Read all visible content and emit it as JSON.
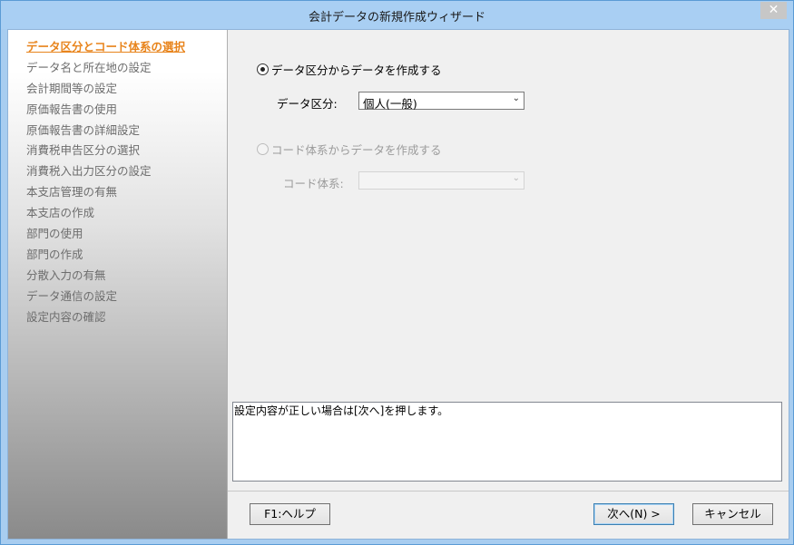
{
  "window": {
    "title": "会計データの新規作成ウィザード",
    "close_glyph": "✕"
  },
  "sidebar": {
    "steps": [
      {
        "label": "データ区分とコード体系の選択",
        "active": true
      },
      {
        "label": "データ名と所在地の設定"
      },
      {
        "label": "会計期間等の設定"
      },
      {
        "label": "原価報告書の使用"
      },
      {
        "label": "原価報告書の詳細設定"
      },
      {
        "label": "消費税申告区分の選択"
      },
      {
        "label": "消費税入出力区分の設定"
      },
      {
        "label": "本支店管理の有無"
      },
      {
        "label": "本支店の作成"
      },
      {
        "label": "部門の使用"
      },
      {
        "label": "部門の作成"
      },
      {
        "label": "分散入力の有無"
      },
      {
        "label": "データ通信の設定"
      },
      {
        "label": "設定内容の確認"
      }
    ]
  },
  "main": {
    "option_data_category": {
      "label": "データ区分からデータを作成する",
      "selected": true
    },
    "data_category_label": "データ区分:",
    "data_category_value": "個人(一般)",
    "option_code_system": {
      "label": "コード体系からデータを作成する",
      "selected": false,
      "enabled": false
    },
    "code_system_label": "コード体系:",
    "code_system_value": "",
    "message": "設定内容が正しい場合は[次へ]を押します。"
  },
  "buttons": {
    "help": "F1:ヘルプ",
    "next": "次へ(N) >",
    "cancel": "キャンセル"
  },
  "colors": {
    "titlebar": "#a9cff3",
    "active_step": "#e8841c",
    "inactive_step": "#6d6d6d"
  }
}
